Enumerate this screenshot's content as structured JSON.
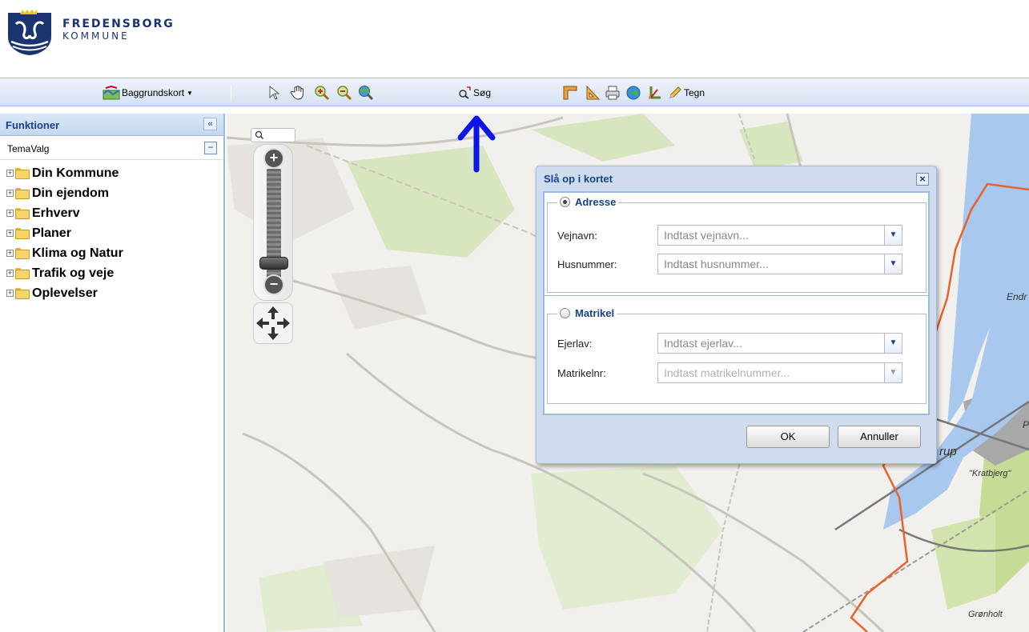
{
  "header": {
    "logo_line1": "FREDENSBORG",
    "logo_line2": "KOMMUNE"
  },
  "toolbar": {
    "background_map_label": "Baggrundskort",
    "search_label": "Søg",
    "draw_label": "Tegn"
  },
  "panel": {
    "title": "Funktioner",
    "collapse_glyph": "«",
    "tema_label": "TemaValg",
    "tema_glyph": "−",
    "items": [
      {
        "label": "Din Kommune"
      },
      {
        "label": "Din ejendom"
      },
      {
        "label": "Erhverv"
      },
      {
        "label": "Planer"
      },
      {
        "label": "Klima og Natur"
      },
      {
        "label": "Trafik og veje"
      },
      {
        "label": "Oplevelser"
      }
    ]
  },
  "dialog": {
    "title": "Slå op i kortet",
    "close_glyph": "×",
    "address_section": {
      "legend": "Adresse",
      "selected": true,
      "street_label": "Vejnavn:",
      "street_placeholder": "Indtast vejnavn...",
      "number_label": "Husnummer:",
      "number_placeholder": "Indtast husnummer..."
    },
    "cadastre_section": {
      "legend": "Matrikel",
      "selected": false,
      "owner_label": "Ejerlav:",
      "owner_placeholder": "Indtast ejerlav...",
      "plot_label": "Matrikelnr:",
      "plot_placeholder": "Indtast matrikelnummer..."
    },
    "ok_label": "OK",
    "cancel_label": "Annuller"
  },
  "map": {
    "labels": {
      "endr": "Endr",
      "rup": "rup",
      "kratbjerg": "\"Kratbjerg\"",
      "gronholt": "Grønholt",
      "p": "P"
    }
  },
  "colors": {
    "brand_blue": "#1a3470",
    "panel_blue": "#15428b",
    "water": "#a9c8ee",
    "forest": "#d5e3b8",
    "municipal_border": "#e8632b",
    "annotation_arrow": "#0a14e6"
  }
}
